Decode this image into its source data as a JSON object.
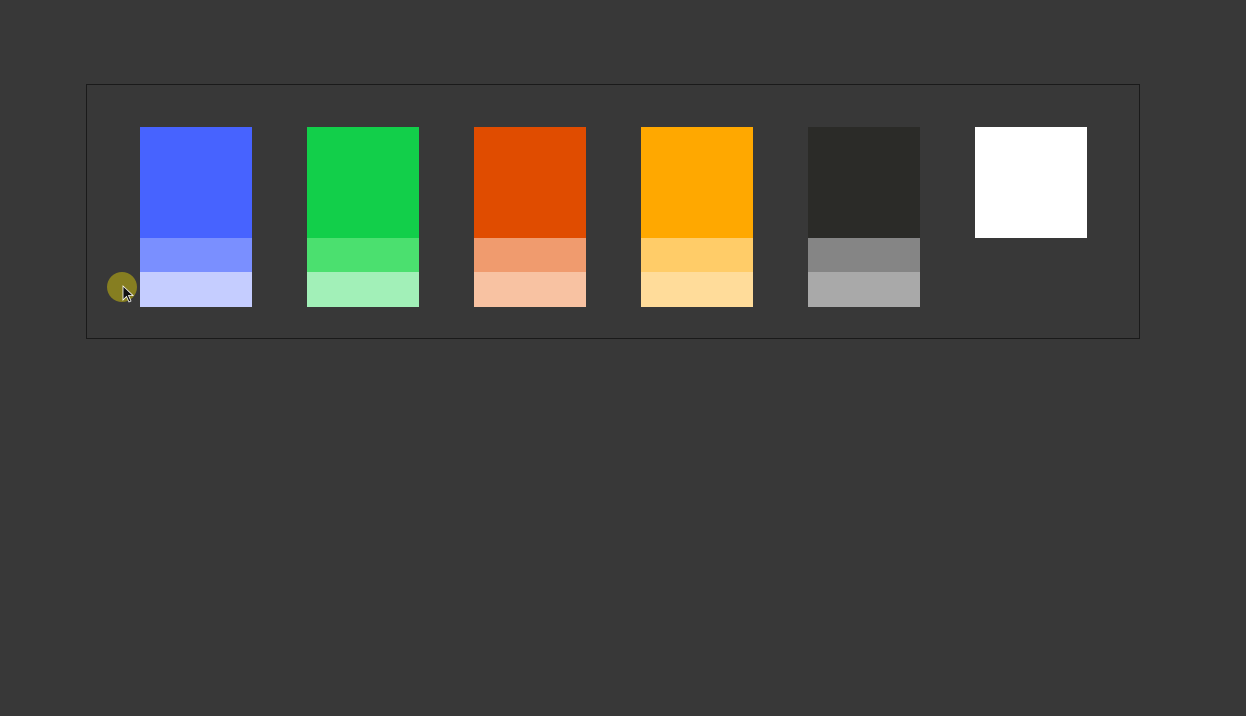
{
  "palette": {
    "colors": [
      {
        "name": "blue",
        "main": "#4763ff",
        "tint": "#7a8fff",
        "light": "#c5cdff"
      },
      {
        "name": "green",
        "main": "#12cf4a",
        "tint": "#4be06f",
        "light": "#a2f0b8"
      },
      {
        "name": "orange",
        "main": "#e04c00",
        "tint": "#f09b6e",
        "light": "#f8c2a2"
      },
      {
        "name": "amber",
        "main": "#ffa800",
        "tint": "#ffcc68",
        "light": "#ffdc9a"
      },
      {
        "name": "black",
        "main": "#2b2b28",
        "tint": "#858585",
        "light": "#a9a9a9"
      },
      {
        "name": "white",
        "main": "#ffffff"
      }
    ]
  },
  "cursor": {
    "highlight_color": "#8a8220",
    "icon": "arrow-cursor-icon"
  }
}
